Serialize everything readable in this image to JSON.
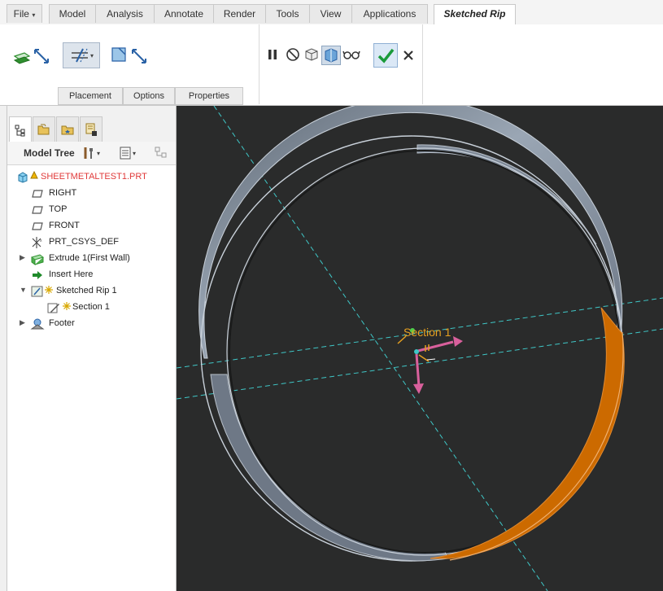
{
  "tabs": {
    "file": "File",
    "items": [
      "Model",
      "Analysis",
      "Annotate",
      "Render",
      "Tools",
      "View",
      "Applications"
    ],
    "active": "Sketched Rip"
  },
  "ribbon": {
    "subtabs": [
      "Placement",
      "Options",
      "Properties"
    ]
  },
  "panel": {
    "title": "Model Tree"
  },
  "tree": [
    {
      "label": "SHEETMETALTEST1.PRT",
      "icon": "part-icon",
      "color": "#e03a3a"
    },
    {
      "label": "RIGHT",
      "icon": "datum-plane-icon"
    },
    {
      "label": "TOP",
      "icon": "datum-plane-icon"
    },
    {
      "label": "FRONT",
      "icon": "datum-plane-icon"
    },
    {
      "label": "PRT_CSYS_DEF",
      "icon": "csys-icon"
    },
    {
      "label": "Extrude 1(First Wall)",
      "icon": "extrude-wall-icon"
    },
    {
      "label": "Insert Here",
      "icon": "insert-arrow-icon"
    },
    {
      "label": "Sketched Rip 1",
      "icon": "sketched-rip-icon"
    },
    {
      "label": "Section 1",
      "icon": "sketch-pencil-icon"
    },
    {
      "label": "Footer",
      "icon": "footer-icon"
    }
  ],
  "viewport": {
    "section_label": "Section 1",
    "colors": {
      "background": "#2a2b2b",
      "wall": "#8a96a4",
      "highlight": "#cc6a00",
      "datum": "#3fc7c7",
      "csys": "#d9609c",
      "section_text": "#e6a020"
    }
  }
}
